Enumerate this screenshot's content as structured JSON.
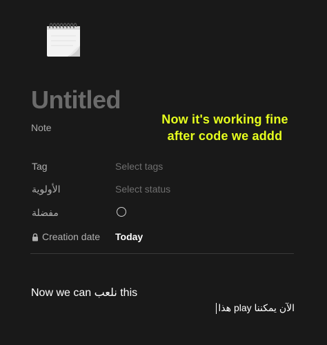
{
  "page": {
    "icon": "notepad-icon",
    "title": "Untitled",
    "database_label": "Note"
  },
  "overlay_note": {
    "line1": "Now it's working fine",
    "line2": "after code we addd",
    "color": "#e6ff1e"
  },
  "properties": [
    {
      "name": "Tag",
      "value": "Select tags",
      "filled": false
    },
    {
      "name": "الأولوية",
      "value": "Select status",
      "filled": false
    },
    {
      "name": "مفضلة",
      "value": "",
      "type": "checkbox",
      "checked": false
    },
    {
      "name": "Creation date",
      "value": "Today",
      "filled": true,
      "icon": "lock-icon"
    }
  ],
  "content": {
    "line1": "Now we can نلعب this",
    "line2": "الآن يمكننا play هذا"
  }
}
